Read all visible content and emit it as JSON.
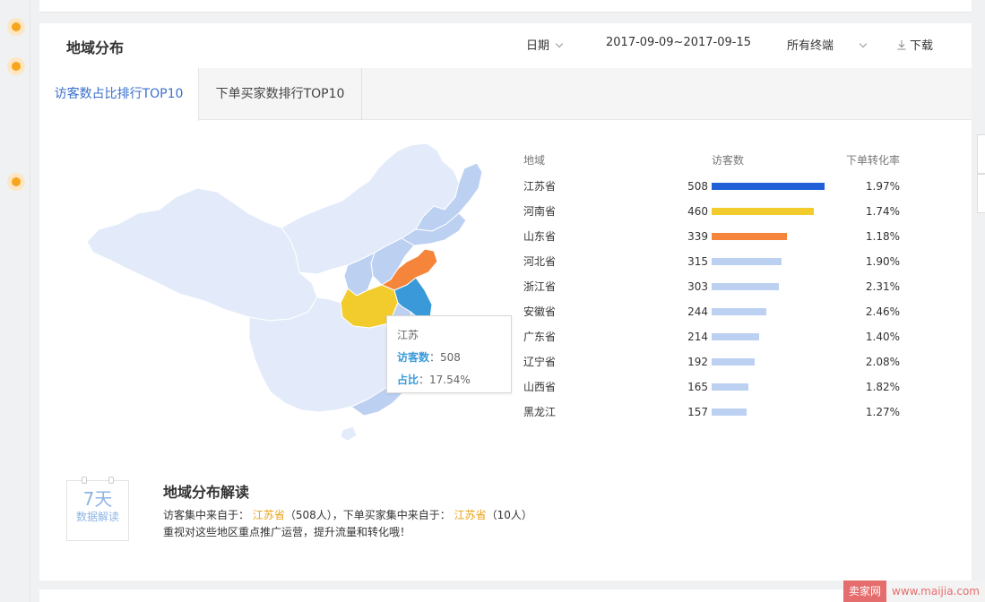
{
  "header": {
    "title": "地域分布",
    "date_label": "日期",
    "date_range": "2017-09-09~2017-09-15",
    "terminal": "所有终端",
    "download": "下载"
  },
  "tabs": [
    {
      "label": "访客数占比排行TOP10",
      "active": true
    },
    {
      "label": "下单买家数排行TOP10",
      "active": false
    }
  ],
  "tooltip": {
    "province": "江苏",
    "visitors_label": "访客数",
    "visitors_value": "：508",
    "share_label": "占比",
    "share_value": "：17.54%"
  },
  "table": {
    "columns": [
      "地域",
      "访客数",
      "下单转化率"
    ],
    "rows": [
      {
        "name": "江苏省",
        "visitors": "508",
        "rate": "1.97%",
        "bar": 508,
        "color": "#2160d6"
      },
      {
        "name": "河南省",
        "visitors": "460",
        "rate": "1.74%",
        "bar": 460,
        "color": "#f2cc2d"
      },
      {
        "name": "山东省",
        "visitors": "339",
        "rate": "1.18%",
        "bar": 339,
        "color": "#f5853b"
      },
      {
        "name": "河北省",
        "visitors": "315",
        "rate": "1.90%",
        "bar": 315,
        "color": "#bcd0f2"
      },
      {
        "name": "浙江省",
        "visitors": "303",
        "rate": "2.31%",
        "bar": 303,
        "color": "#bcd0f2"
      },
      {
        "name": "安徽省",
        "visitors": "244",
        "rate": "2.46%",
        "bar": 244,
        "color": "#bcd0f2"
      },
      {
        "name": "广东省",
        "visitors": "214",
        "rate": "1.40%",
        "bar": 214,
        "color": "#bcd0f2"
      },
      {
        "name": "辽宁省",
        "visitors": "192",
        "rate": "2.08%",
        "bar": 192,
        "color": "#bcd0f2"
      },
      {
        "name": "山西省",
        "visitors": "165",
        "rate": "1.82%",
        "bar": 165,
        "color": "#bcd0f2"
      },
      {
        "name": "黑龙江",
        "visitors": "157",
        "rate": "1.27%",
        "bar": 157,
        "color": "#bcd0f2"
      }
    ]
  },
  "interpretation": {
    "badge_big": "7天",
    "badge_small": "数据解读",
    "title": "地域分布解读",
    "line1_prefix": "访客集中来自于：",
    "line1_province": "江苏省",
    "line1_count": "（508人），下单买家集中来自于：",
    "line1_province2": "江苏省",
    "line1_count2": "（10人）",
    "line2": "重视对这些地区重点推广运营，提升流量和转化哦！"
  },
  "watermark": {
    "logo": "卖家网",
    "url": "www.maijia.com"
  },
  "colors": {
    "accent": "#3a6fcc",
    "highlight": "#e8a317",
    "map_base": "#e3ebfa",
    "map_light": "#bcd0f2"
  }
}
